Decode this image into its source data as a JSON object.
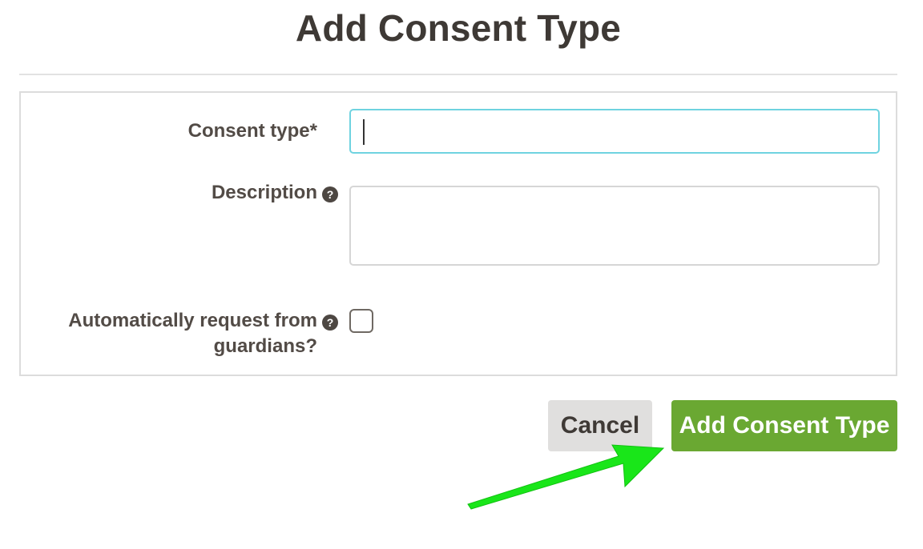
{
  "modal": {
    "title": "Add Consent Type"
  },
  "form": {
    "consent_type_label": "Consent type*",
    "consent_type_value": "",
    "description_label": "Description",
    "description_value": "",
    "auto_request_label_line1": "Automatically request from",
    "auto_request_label_line2": "guardians?",
    "auto_request_checked": false,
    "help_glyph": "?"
  },
  "buttons": {
    "cancel_label": "Cancel",
    "submit_label": "Add Consent Type"
  },
  "icons": {
    "help": "question-circle-icon",
    "annotation": "green-arrow-icon"
  },
  "colors": {
    "primary_button": "#6aa832",
    "focus_border": "#6fd3e0",
    "annotation_arrow": "#19e619"
  }
}
